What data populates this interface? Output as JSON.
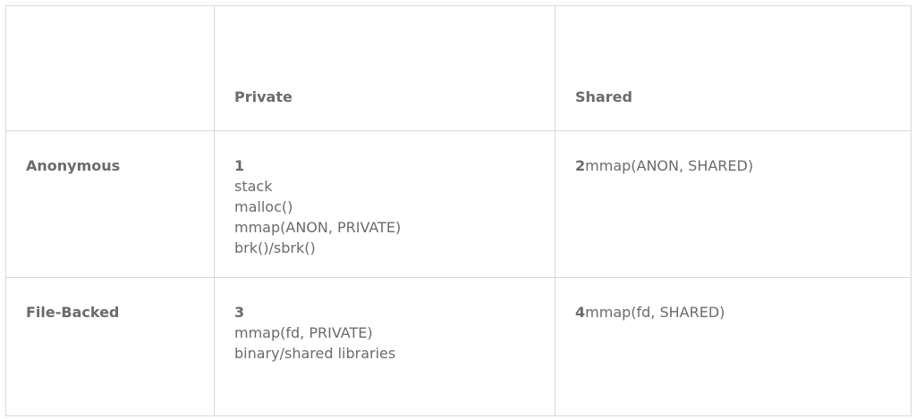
{
  "table": {
    "columns": [
      "",
      "Private",
      "Shared"
    ],
    "rows": [
      {
        "label": "Anonymous",
        "private": {
          "number": "1",
          "lines": [
            "stack",
            "malloc()",
            "mmap(ANON, PRIVATE)",
            "brk()/sbrk()"
          ]
        },
        "shared": {
          "number": "2",
          "text": "mmap(ANON, SHARED)"
        }
      },
      {
        "label": "File-Backed",
        "private": {
          "number": "3",
          "lines": [
            "mmap(fd, PRIVATE)",
            "binary/shared libraries"
          ]
        },
        "shared": {
          "number": "4",
          "text": "mmap(fd, SHARED)"
        }
      }
    ]
  }
}
